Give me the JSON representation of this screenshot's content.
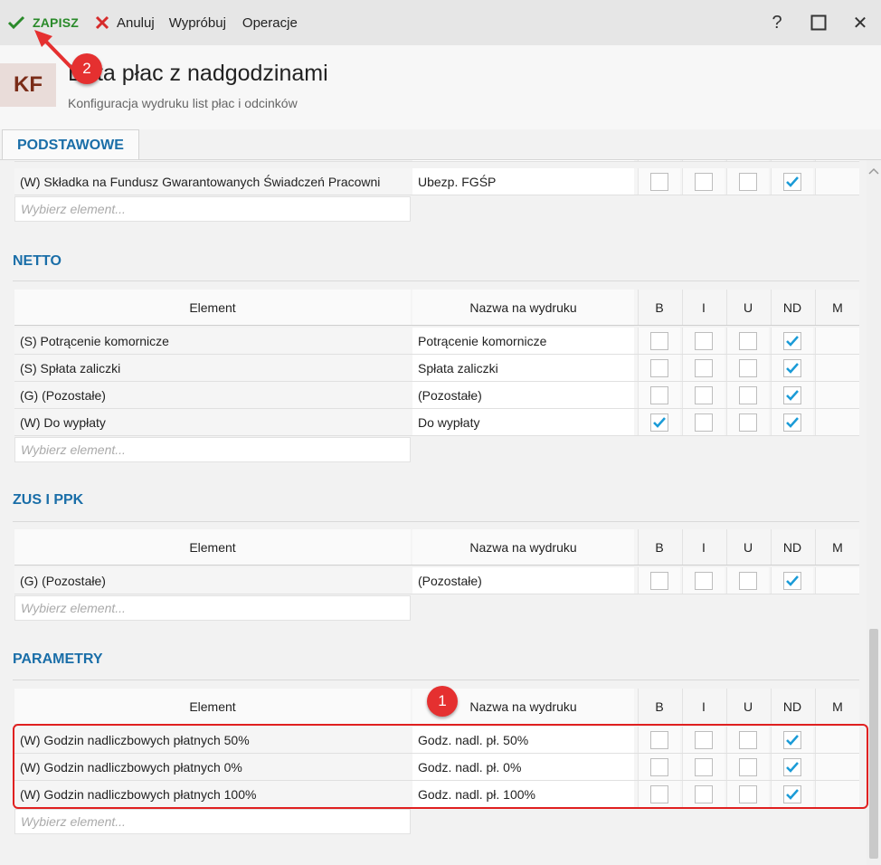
{
  "toolbar": {
    "save_label": "ZAPISZ",
    "cancel_label": "Anuluj",
    "try_label": "Wypróbuj",
    "operations_label": "Operacje",
    "help_glyph": "?",
    "close_glyph": "✕"
  },
  "header": {
    "logo": "KF",
    "title": "Lista płac z nadgodzinami",
    "subtitle": "Konfiguracja wydruku list płac i odcinków"
  },
  "tabs": [
    {
      "label": "PODSTAWOWE",
      "active": true
    }
  ],
  "columns": {
    "element": "Element",
    "name": "Nazwa na wydruku",
    "b": "B",
    "i": "I",
    "u": "U",
    "nd": "ND",
    "m": "M"
  },
  "picker_placeholder": "Wybierz element...",
  "podstawowe": {
    "rows": [
      {
        "element": "(W) Składka na Fundusz Gwarantowanych Świadczeń Pracowni",
        "name": "Ubezp. FGŚP",
        "b": false,
        "i": false,
        "u": false,
        "nd": true
      }
    ]
  },
  "netto": {
    "title": "NETTO",
    "rows": [
      {
        "element": "(S) Potrącenie komornicze",
        "name": "Potrącenie komornicze",
        "b": false,
        "i": false,
        "u": false,
        "nd": true
      },
      {
        "element": "(S) Spłata zaliczki",
        "name": "Spłata zaliczki",
        "b": false,
        "i": false,
        "u": false,
        "nd": true
      },
      {
        "element": "(G) (Pozostałe)",
        "name": "(Pozostałe)",
        "b": false,
        "i": false,
        "u": false,
        "nd": true
      },
      {
        "element": "(W) Do wypłaty",
        "name": "Do wypłaty",
        "b": true,
        "i": false,
        "u": false,
        "nd": true
      }
    ]
  },
  "zus": {
    "title": "ZUS I PPK",
    "rows": [
      {
        "element": "(G) (Pozostałe)",
        "name": "(Pozostałe)",
        "b": false,
        "i": false,
        "u": false,
        "nd": true
      }
    ]
  },
  "parametry": {
    "title": "PARAMETRY",
    "rows": [
      {
        "element": "(W) Godzin nadliczbowych płatnych 50%",
        "name": "Godz. nadl. pł. 50%",
        "b": false,
        "i": false,
        "u": false,
        "nd": true
      },
      {
        "element": "(W) Godzin nadliczbowych płatnych 0%",
        "name": "Godz. nadl. pł. 0%",
        "b": false,
        "i": false,
        "u": false,
        "nd": true
      },
      {
        "element": "(W) Godzin nadliczbowych płatnych 100%",
        "name": "Godz. nadl. pł. 100%",
        "b": false,
        "i": false,
        "u": false,
        "nd": true
      }
    ]
  },
  "annotations": {
    "badge1": "1",
    "badge2": "2",
    "color": "#e53030"
  },
  "colors": {
    "accent": "#1a6ea8",
    "save": "#2a8a2a",
    "cancel": "#d62b2b",
    "check": "#1a9bd7"
  }
}
